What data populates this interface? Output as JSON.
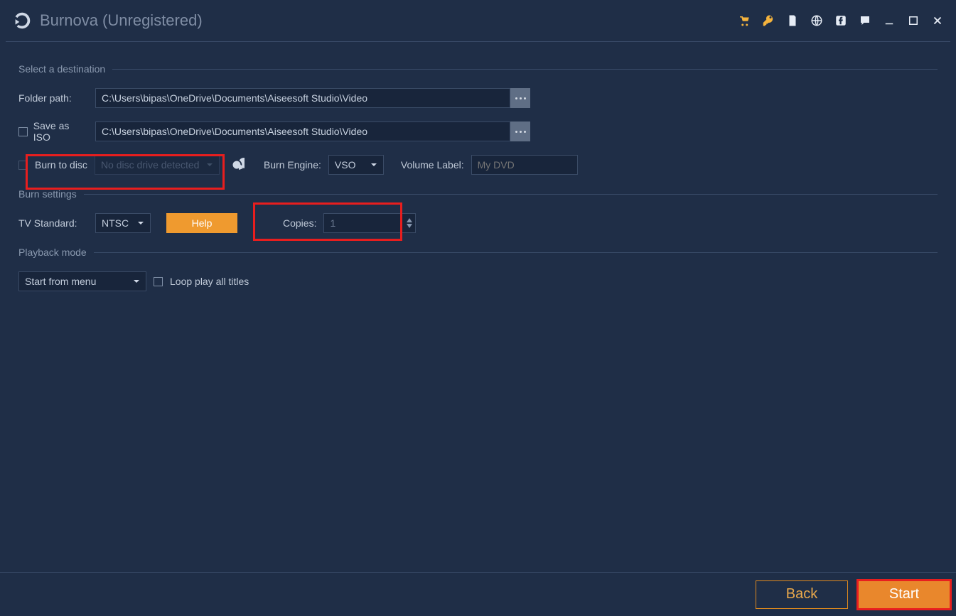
{
  "app": {
    "title": "Burnova (Unregistered)"
  },
  "sections": {
    "destination": {
      "title": "Select a destination",
      "folder_label": "Folder path:",
      "folder_value": "C:\\Users\\bipas\\OneDrive\\Documents\\Aiseesoft Studio\\Video",
      "iso_label": "Save as ISO",
      "iso_value": "C:\\Users\\bipas\\OneDrive\\Documents\\Aiseesoft Studio\\Video",
      "burn_label": "Burn to disc",
      "burn_drive_placeholder": "No disc drive detected",
      "engine_label": "Burn Engine:",
      "engine_value": "VSO",
      "volume_label": "Volume Label:",
      "volume_placeholder": "My DVD"
    },
    "burn": {
      "title": "Burn settings",
      "tv_label": "TV Standard:",
      "tv_value": "NTSC",
      "help_label": "Help",
      "copies_label": "Copies:",
      "copies_value": "1"
    },
    "playback": {
      "title": "Playback mode",
      "mode_value": "Start from menu",
      "loop_label": "Loop play all titles"
    }
  },
  "footer": {
    "back": "Back",
    "start": "Start"
  }
}
